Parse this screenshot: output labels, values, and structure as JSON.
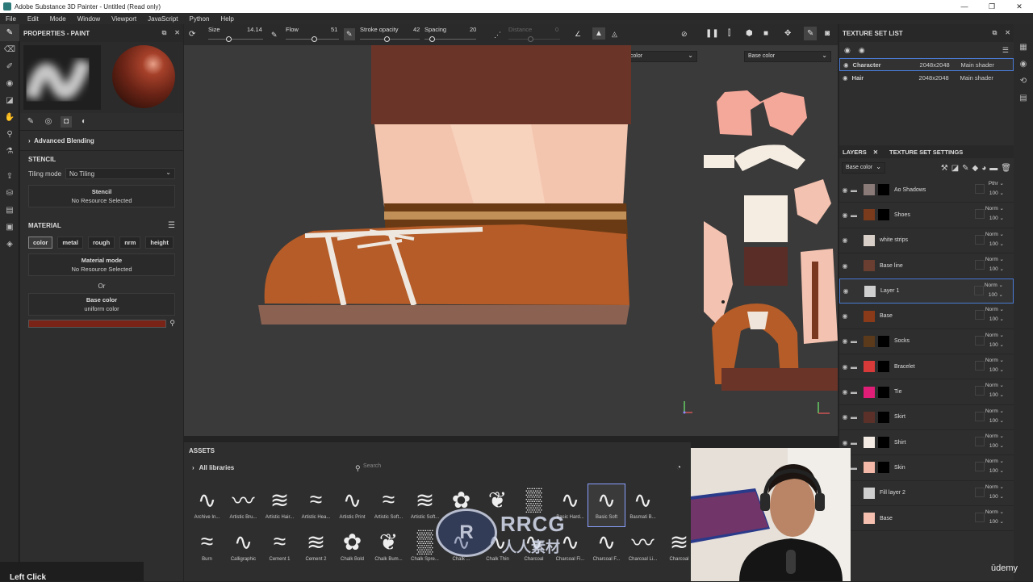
{
  "titlebar": {
    "title": "Adobe Substance 3D Painter - Untitled (Read only)"
  },
  "menu": [
    "File",
    "Edit",
    "Mode",
    "Window",
    "Viewport",
    "JavaScript",
    "Python",
    "Help"
  ],
  "properties": {
    "title": "PROPERTIES - PAINT",
    "advanced_blending": "Advanced Blending",
    "stencil_title": "STENCIL",
    "tiling_label": "Tiling mode",
    "tiling_value": "No Tiling",
    "stencil_box_title": "Stencil",
    "stencil_box_sub": "No Resource Selected",
    "material_title": "MATERIAL",
    "chips": [
      "color",
      "metal",
      "rough",
      "nrm",
      "height"
    ],
    "material_mode_title": "Material mode",
    "material_mode_sub": "No Resource Selected",
    "or": "Or",
    "base_color_title": "Base color",
    "base_color_sub": "uniform color",
    "base_color_swatch": "#7a2418"
  },
  "toolbar": {
    "size_label": "Size",
    "size_value": "14.14",
    "flow_label": "Flow",
    "flow_value": "51",
    "stroke_label": "Stroke opacity",
    "stroke_value": "42",
    "spacing_label": "Spacing",
    "spacing_value": "20",
    "distance_label": "Distance",
    "distance_value": "0"
  },
  "viewport": {
    "channel_3d": "Base color",
    "channel_2d": "Base color"
  },
  "assets": {
    "title": "ASSETS",
    "library": "All libraries",
    "search_placeholder": "Search",
    "brushes_row1": [
      "Archive In...",
      "Artistic Bru...",
      "Artistic Hair...",
      "Artistic Hea...",
      "Artistic Print",
      "Artistic Soft...",
      "Artistic Soft...",
      "",
      "",
      "",
      "Basic Hard...",
      "Basic Soft",
      "Basmati B..."
    ],
    "brushes_row2": [
      "Burn",
      "Calligraphic",
      "Cement 1",
      "Cement 2",
      "Chalk Bold",
      "Chalk Bum...",
      "Chalk Spre...",
      "Chalk ...",
      "Chalk Thin",
      "Charcoal",
      "Charcoal Fi...",
      "Charcoal F...",
      "Charcoal Li...",
      "Charcoal"
    ]
  },
  "texture_set_list": {
    "title": "TEXTURE SET LIST",
    "rows": [
      {
        "name": "Character",
        "res": "2048x2048",
        "shader": "Main shader"
      },
      {
        "name": "Hair",
        "res": "2048x2048",
        "shader": "Main shader"
      }
    ]
  },
  "layers_panel": {
    "tab_layers": "LAYERS",
    "tab_settings": "TEXTURE SET SETTINGS",
    "channel": "Base color",
    "layers": [
      {
        "name": "Ao Shadows",
        "blend": "Pthr",
        "opacity": "100",
        "color": "#8a7a78",
        "folder": true
      },
      {
        "name": "Shoes",
        "blend": "Norm",
        "opacity": "100",
        "color": "#7a3a1c",
        "folder": true
      },
      {
        "name": "white strips",
        "blend": "Norm",
        "opacity": "100",
        "color": "#d8d0c8",
        "folder": false
      },
      {
        "name": "Base line",
        "blend": "Norm",
        "opacity": "100",
        "color": "#6a3e30",
        "folder": false
      },
      {
        "name": "Layer 1",
        "blend": "Norm",
        "opacity": "100",
        "color": "#cfcfcf",
        "folder": false
      },
      {
        "name": "Base",
        "blend": "Norm",
        "opacity": "100",
        "color": "#8a3a18",
        "folder": false
      },
      {
        "name": "Socks",
        "blend": "Norm",
        "opacity": "100",
        "color": "#5a3a1a",
        "folder": true
      },
      {
        "name": "Bracelet",
        "blend": "Norm",
        "opacity": "100",
        "color": "#d83a3a",
        "folder": true
      },
      {
        "name": "Tie",
        "blend": "Norm",
        "opacity": "100",
        "color": "#e01e78",
        "folder": true
      },
      {
        "name": "Skirt",
        "blend": "Norm",
        "opacity": "100",
        "color": "#5a3028",
        "folder": true
      },
      {
        "name": "Shirt",
        "blend": "Norm",
        "opacity": "100",
        "color": "#f4ece4",
        "folder": true
      },
      {
        "name": "Skin",
        "blend": "Norm",
        "opacity": "100",
        "color": "#f3b8a8",
        "folder": true
      },
      {
        "name": "Fill layer 2",
        "blend": "Norm",
        "opacity": "100",
        "color": "#cfcfcf",
        "folder": false
      },
      {
        "name": "Base",
        "blend": "Norm",
        "opacity": "100",
        "color": "#f6c0b0",
        "folder": false
      }
    ]
  },
  "watermark": {
    "line1": "RRCG",
    "line2": "人人素材",
    "udemy": "ūdemy"
  },
  "overlay": {
    "bottom_text": "Left Click"
  }
}
